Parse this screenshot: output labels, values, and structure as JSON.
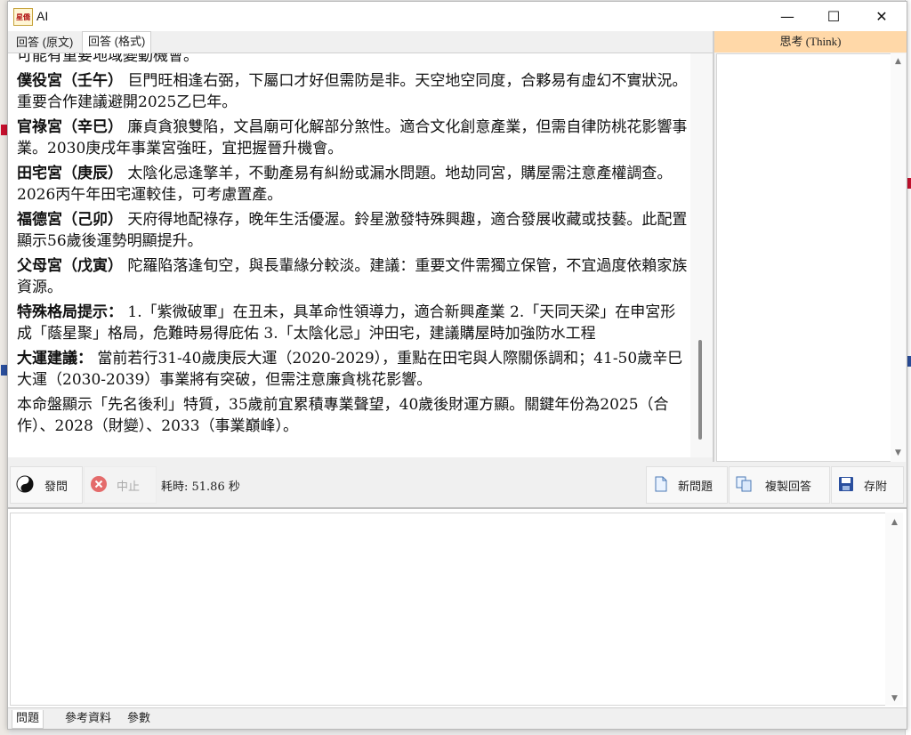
{
  "window": {
    "title": "AI",
    "minimize": "—",
    "maximize": "☐",
    "close": "✕"
  },
  "tabs": [
    {
      "label": "回答 (原文)"
    },
    {
      "label": "回答 (格式)"
    }
  ],
  "answer": {
    "paragraphs": [
      {
        "head": "",
        "body": "可能有重要地域變動機會。"
      },
      {
        "head": "僕役宮（壬午）",
        "body": "巨門旺相逢右弼，下屬口才好但需防是非。天空地空同度，合夥易有虛幻不實狀況。重要合作建議避開2025乙巳年。"
      },
      {
        "head": "官祿宮（辛巳）",
        "body": "廉貞貪狼雙陷，文昌廟可化解部分煞性。適合文化創意產業，但需自律防桃花影響事業。2030庚戌年事業宮強旺，宜把握晉升機會。"
      },
      {
        "head": "田宅宮（庚辰）",
        "body": "太陰化忌逢擎羊，不動產易有糾紛或漏水問題。地劫同宮，購屋需注意產權調查。2026丙午年田宅運較佳，可考慮置產。"
      },
      {
        "head": "福德宮（己卯）",
        "body": "天府得地配祿存，晚年生活優渥。鈴星激發特殊興趣，適合發展收藏或技藝。此配置顯示56歲後運勢明顯提升。"
      },
      {
        "head": "父母宮（戊寅）",
        "body": "陀羅陷落逢旬空，與長輩緣分較淡。建議：重要文件需獨立保管，不宜過度依賴家族資源。"
      },
      {
        "head": "特殊格局提示：",
        "body": "1.「紫微破軍」在丑未，具革命性領導力，適合新興產業 2.「天同天梁」在申宮形成「蔭星聚」格局，危難時易得庇佑 3.「太陰化忌」沖田宅，建議購屋時加強防水工程"
      },
      {
        "head": "大運建議：",
        "body": "當前若行31-40歲庚辰大運（2020-2029），重點在田宅與人際關係調和；41-50歲辛巳大運（2030-2039）事業將有突破，但需注意廉貪桃花影響。"
      },
      {
        "head": "",
        "body": "本命盤顯示「先名後利」特質，35歲前宜累積專業聲望，40歲後財運方顯。關鍵年份為2025（合作）、2028（財變）、2033（事業巔峰）。"
      }
    ]
  },
  "think": {
    "header": "思考 (Think)"
  },
  "toolbar": {
    "ask": "發問",
    "stop": "中止",
    "elapsed": "耗時: 51.86 秒",
    "new_question": "新問題",
    "copy_answer": "複製回答",
    "save": "存附"
  },
  "bottom_tabs": [
    {
      "label": "問題"
    },
    {
      "label": "參考資料"
    },
    {
      "label": "參數"
    }
  ],
  "icon_text": {
    "app": "星僑"
  },
  "colors": {
    "think_header": "#ffd8a8",
    "stop_red": "#e46b6b",
    "save_blue": "#2a4f9e"
  }
}
